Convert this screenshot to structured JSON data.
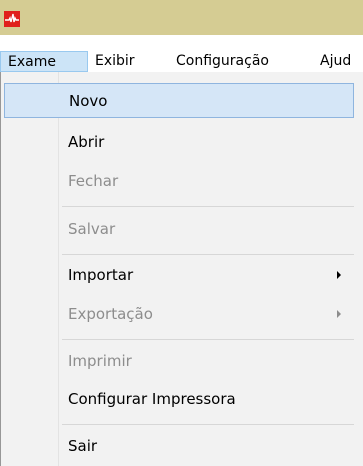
{
  "app": {
    "icon": "heartbeat-icon",
    "accent_color": "#e0201c",
    "titlebar_color": "#d5cc93"
  },
  "menubar": {
    "items": [
      {
        "label": "Exame",
        "active": true
      },
      {
        "label": "Exibir",
        "active": false
      },
      {
        "label": "Configuração",
        "active": false
      },
      {
        "label": "Ajud",
        "active": false
      }
    ]
  },
  "dropdown": {
    "items": [
      {
        "label": "Novo",
        "enabled": true,
        "highlighted": true
      },
      {
        "label": "Abrir",
        "enabled": true
      },
      {
        "label": "Fechar",
        "enabled": false
      },
      {
        "label": "Salvar",
        "enabled": false
      },
      {
        "label": "Importar",
        "enabled": true,
        "submenu": true
      },
      {
        "label": "Exportação",
        "enabled": false,
        "submenu": true
      },
      {
        "label": "Imprimir",
        "enabled": false
      },
      {
        "label": "Configurar Impressora",
        "enabled": true
      },
      {
        "label": "Sair",
        "enabled": true
      }
    ]
  }
}
